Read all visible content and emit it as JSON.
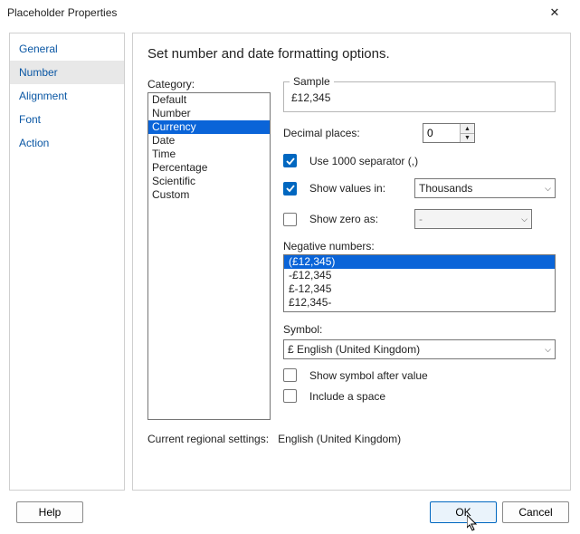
{
  "title": "Placeholder Properties",
  "sidebar": {
    "items": [
      {
        "label": "General"
      },
      {
        "label": "Number"
      },
      {
        "label": "Alignment"
      },
      {
        "label": "Font"
      },
      {
        "label": "Action"
      }
    ],
    "selected_index": 1
  },
  "main": {
    "heading": "Set number and date formatting options.",
    "category_label": "Category:",
    "categories": [
      "Default",
      "Number",
      "Currency",
      "Date",
      "Time",
      "Percentage",
      "Scientific",
      "Custom"
    ],
    "category_selected_index": 2,
    "sample_label": "Sample",
    "sample_value": "£12,345",
    "decimal_label": "Decimal places:",
    "decimal_value": "0",
    "use_separator_label": "Use 1000 separator (,)",
    "use_separator_checked": true,
    "show_values_label": "Show values in:",
    "show_values_checked": true,
    "show_values_value": "Thousands",
    "show_zero_label": "Show zero as:",
    "show_zero_checked": false,
    "show_zero_value": "-",
    "negative_label": "Negative numbers:",
    "negative_options": [
      "(£12,345)",
      "-£12,345",
      "£-12,345",
      "£12,345-"
    ],
    "negative_selected_index": 0,
    "symbol_label": "Symbol:",
    "symbol_value": "£ English (United Kingdom)",
    "show_symbol_after_label": "Show symbol after value",
    "show_symbol_after_checked": false,
    "include_space_label": "Include a space",
    "include_space_checked": false,
    "regional_label": "Current regional settings:",
    "regional_value": "English (United Kingdom)"
  },
  "footer": {
    "help": "Help",
    "ok": "OK",
    "cancel": "Cancel"
  },
  "glyphs": {
    "up": "▲",
    "down": "▼",
    "chevron": "⌵",
    "close": "✕"
  }
}
